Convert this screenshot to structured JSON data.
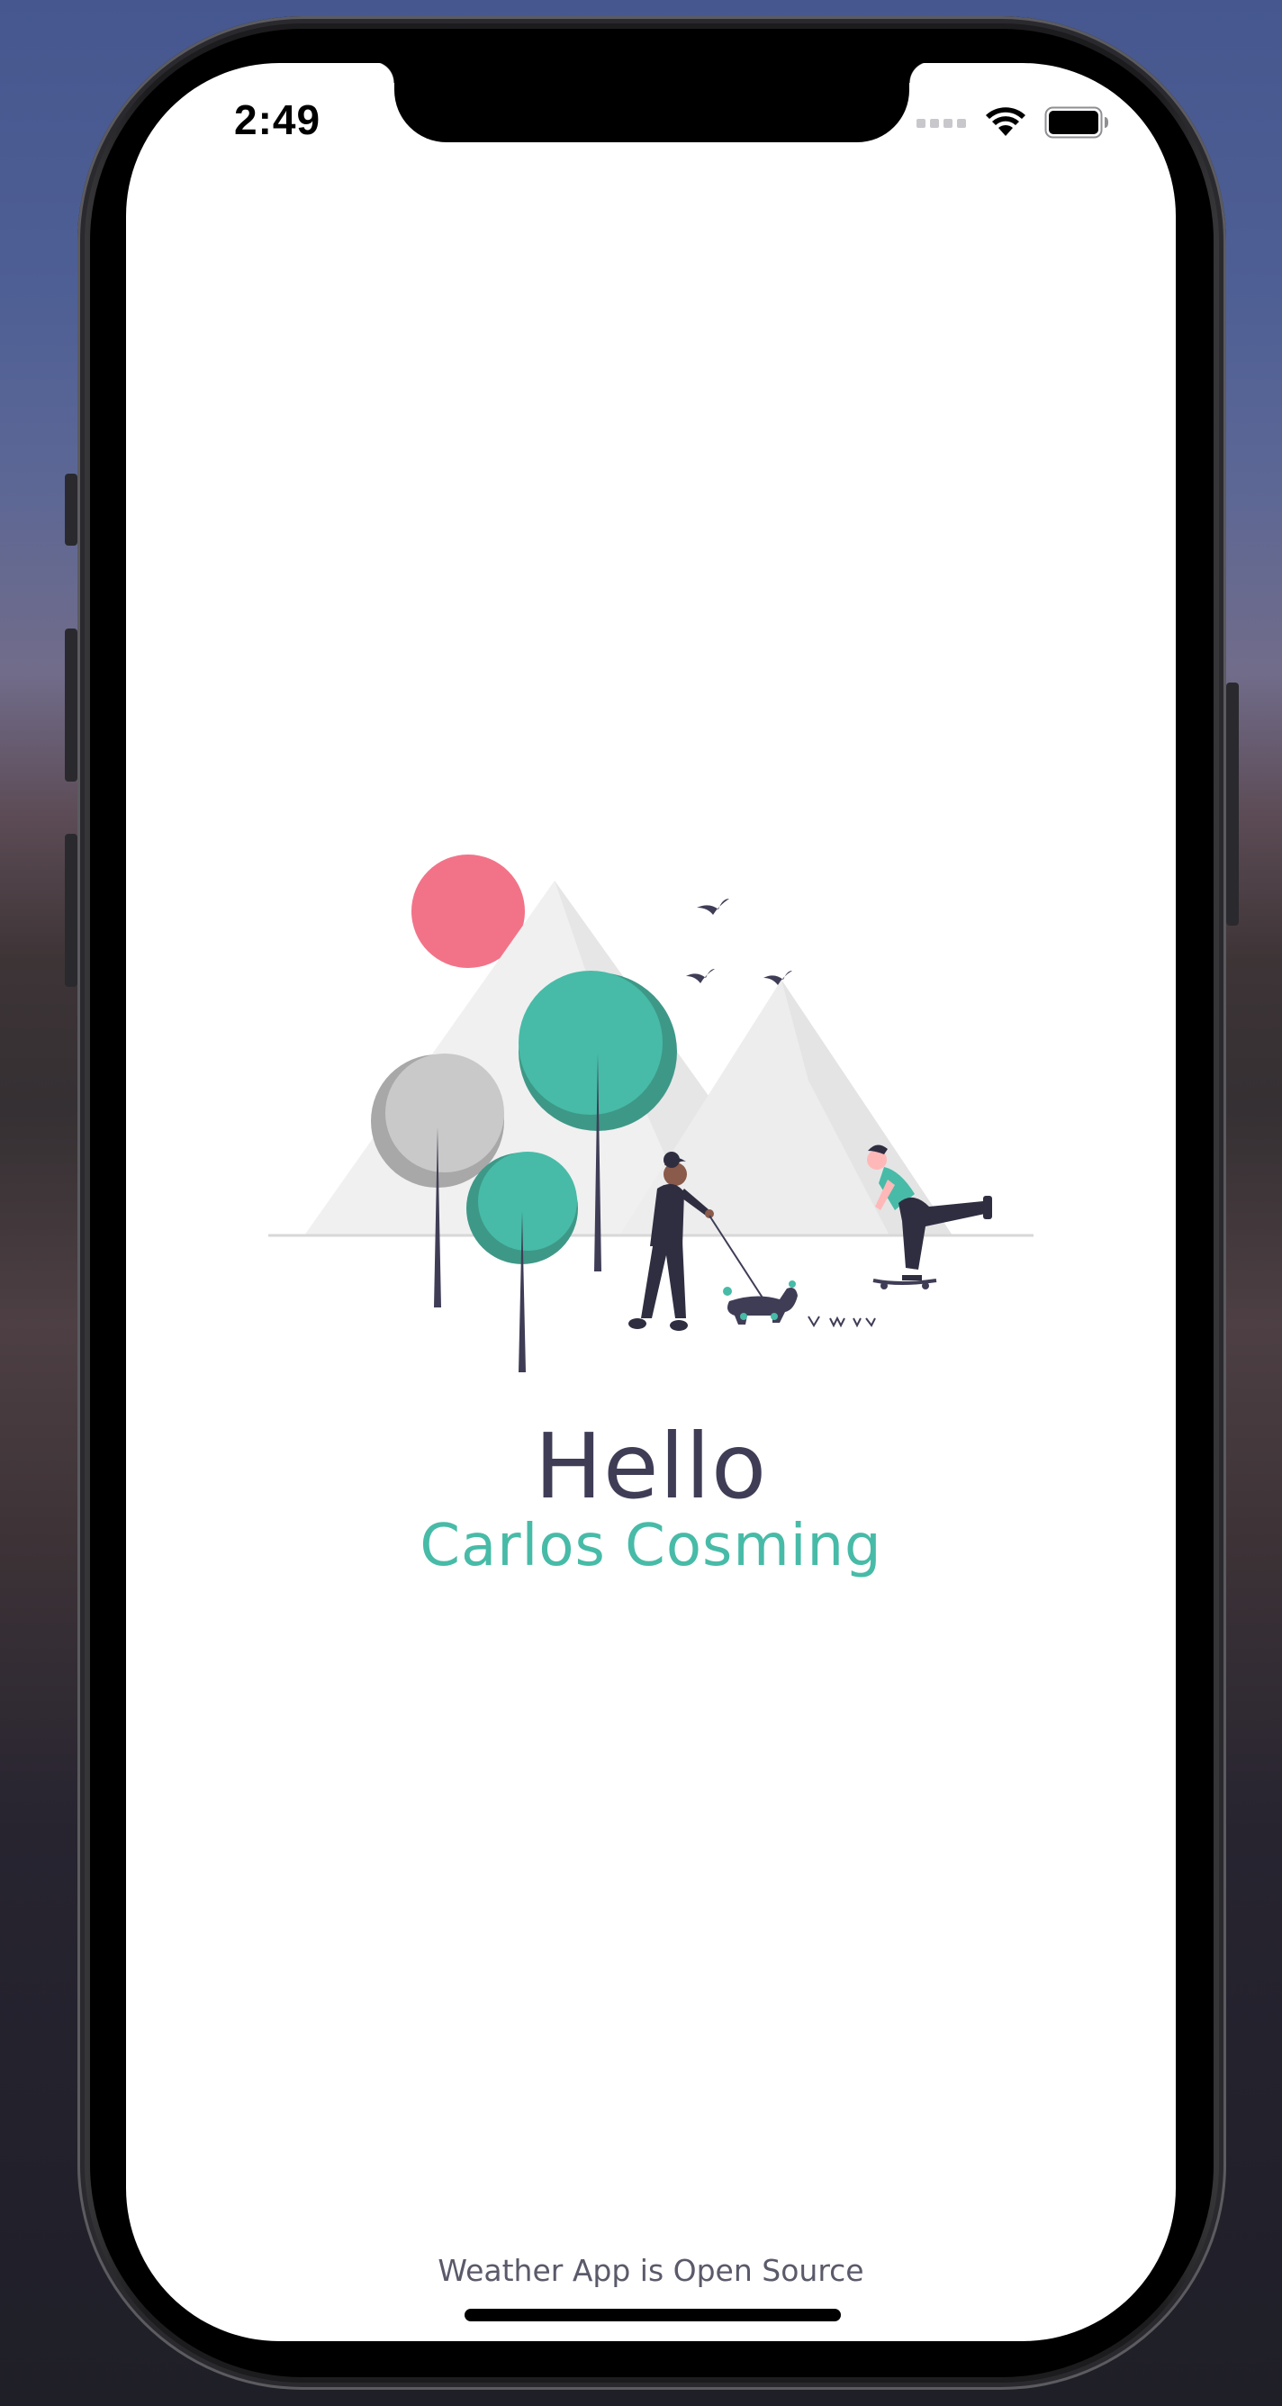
{
  "status_bar": {
    "time": "2:49",
    "icons": [
      "cellular-signal-icon",
      "wifi-icon",
      "battery-icon"
    ]
  },
  "main": {
    "greeting": "Hello",
    "user_name": "Carlos Cosming"
  },
  "footer": {
    "note": "Weather App is Open Source"
  },
  "colors": {
    "accent": "#47bba7",
    "text_dark": "#3f3d56",
    "pink": "#f27388"
  }
}
